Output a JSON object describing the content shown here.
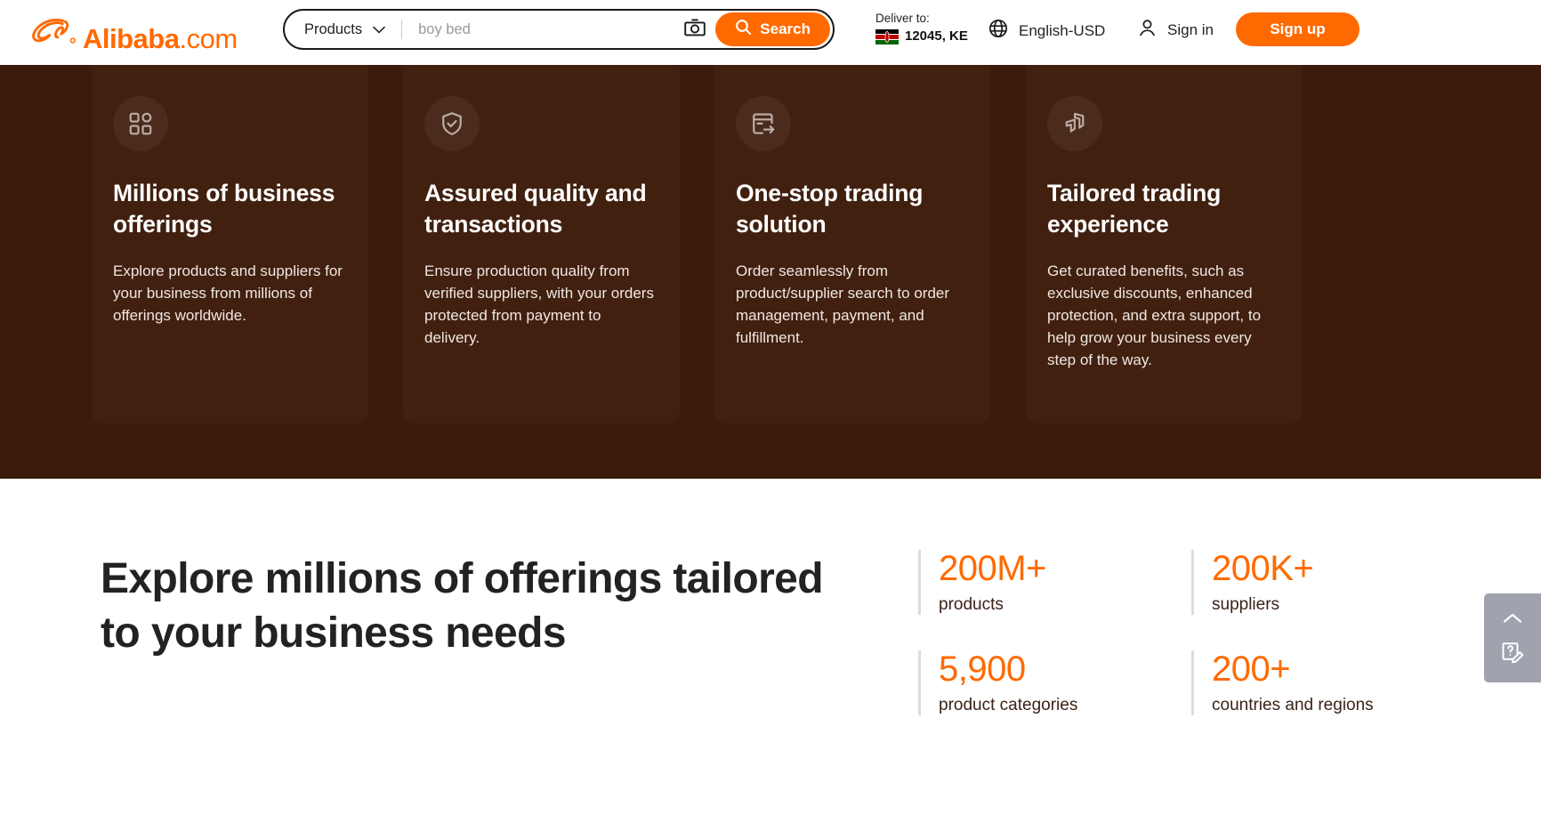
{
  "header": {
    "logo": {
      "brand": "Alibaba",
      "suffix": ".com",
      "icon": "alibaba-logo-icon"
    },
    "search": {
      "category_label": "Products",
      "category_icon": "chevron-down-icon",
      "input_value": "boy bed",
      "placeholder": "boy bed",
      "camera_icon": "camera-icon",
      "search_icon": "search-icon",
      "search_label": "Search"
    },
    "deliver": {
      "label": "Deliver to:",
      "flag_icon": "kenya-flag-icon",
      "value": "12045, KE"
    },
    "language": {
      "icon": "globe-icon",
      "label": "English-USD"
    },
    "signin": {
      "icon": "user-icon",
      "label": "Sign in"
    },
    "signup": {
      "label": "Sign up"
    },
    "accent_color": "#FF6A00"
  },
  "banner": {
    "background_color": "#3A1B0C",
    "card_color": "#41200F",
    "cards": [
      {
        "icon": "grid-apps-icon",
        "title": "Millions of business offerings",
        "desc": "Explore products and suppliers for your business from millions of offerings worldwide."
      },
      {
        "icon": "shield-check-icon",
        "title": "Assured quality and transactions",
        "desc": "Ensure production quality from verified suppliers, with your orders protected from payment to delivery."
      },
      {
        "icon": "order-arrow-icon",
        "title": "One-stop trading solution",
        "desc": "Order seamlessly from product/supplier search to order management, payment, and fulfillment."
      },
      {
        "icon": "layers-icon",
        "title": "Tailored trading experience",
        "desc": "Get curated benefits, such as exclusive discounts, enhanced protection, and extra support, to help grow your business every step of the way."
      }
    ]
  },
  "explore": {
    "heading": "Explore millions of offerings tailored to your business needs",
    "stats": [
      {
        "value": "200M+",
        "label": "products"
      },
      {
        "value": "200K+",
        "label": "suppliers"
      },
      {
        "value": "5,900",
        "label": "product categories"
      },
      {
        "value": "200+",
        "label": "countries and regions"
      }
    ],
    "stat_color": "#FF6A00"
  },
  "float_widget": {
    "background_color": "#A0A3AE",
    "scroll_top_icon": "chevron-up-icon",
    "feedback_icon": "feedback-pencil-icon"
  }
}
